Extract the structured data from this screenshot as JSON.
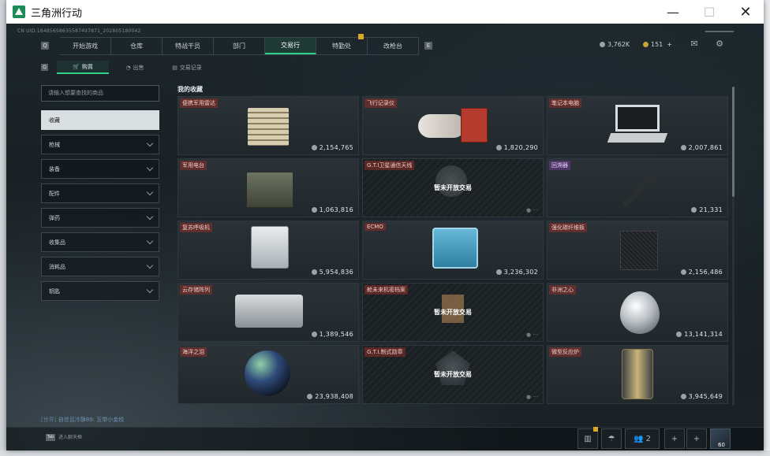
{
  "window": {
    "title": "三角洲行动"
  },
  "uid": "CN UID:18485658635587497871_202805180042",
  "nav": {
    "q_key": "Q",
    "e_key": "E",
    "tabs": [
      {
        "label": "开始游戏"
      },
      {
        "label": "仓库"
      },
      {
        "label": "特战干员"
      },
      {
        "label": "部门"
      },
      {
        "label": "交易行",
        "active": true
      },
      {
        "label": "特勤处"
      },
      {
        "label": "改枪台"
      }
    ]
  },
  "currency": {
    "silver": "3,762K",
    "gold": "151",
    "add": "+"
  },
  "subtabs": {
    "q_key": "Q",
    "items": [
      {
        "label": "购買",
        "active": true
      },
      {
        "label": "出售"
      },
      {
        "label": "交易记录"
      }
    ]
  },
  "sidebar": {
    "search_placeholder": "请输入想要查找的商品",
    "items": [
      {
        "label": "收藏",
        "active": true
      },
      {
        "label": "枪械"
      },
      {
        "label": "装备"
      },
      {
        "label": "配件"
      },
      {
        "label": "弹药"
      },
      {
        "label": "收集品"
      },
      {
        "label": "消耗品"
      },
      {
        "label": "钥匙"
      }
    ]
  },
  "favorites": {
    "title": "我的收藏",
    "locked_text": "暂未开放交易",
    "items": [
      {
        "name": "便携军用雷达",
        "price": "2,154,765",
        "rarity": "red",
        "locked": false
      },
      {
        "name": "飞行记录仪",
        "price": "1,820,290",
        "rarity": "red",
        "locked": false
      },
      {
        "name": "笔记本电脑",
        "price": "2,007,861",
        "rarity": "red",
        "locked": false
      },
      {
        "name": "军用电台",
        "price": "1,063,816",
        "rarity": "red",
        "locked": false
      },
      {
        "name": "G.T.I卫星通信天线",
        "price": "",
        "rarity": "red",
        "locked": true
      },
      {
        "name": "回溯器",
        "price": "21,331",
        "rarity": "purple",
        "locked": false
      },
      {
        "name": "复苏呼吸机",
        "price": "5,954,836",
        "rarity": "red",
        "locked": false
      },
      {
        "name": "ECMO",
        "price": "3,236,302",
        "rarity": "red",
        "locked": false
      },
      {
        "name": "强化碳纤维板",
        "price": "2,156,486",
        "rarity": "red",
        "locked": false
      },
      {
        "name": "云存储阵列",
        "price": "1,389,546",
        "rarity": "red",
        "locked": false
      },
      {
        "name": "舱未来机密档案",
        "price": "",
        "rarity": "red",
        "locked": true
      },
      {
        "name": "非洲之心",
        "price": "13,141,314",
        "rarity": "red",
        "locked": false
      },
      {
        "name": "海洋之泪",
        "price": "23,938,408",
        "rarity": "red",
        "locked": false
      },
      {
        "name": "G.T.I.制式勋章",
        "price": "",
        "rarity": "red",
        "locked": true
      },
      {
        "name": "微型反应炉",
        "price": "3,945,649",
        "rarity": "red",
        "locked": false
      }
    ]
  },
  "chat": {
    "channel": "[世界]",
    "message": "自信且冷静89: 互带小金校"
  },
  "bottom": {
    "tab_key": "Tab",
    "hint": "进入聊天框",
    "friends": "2",
    "level": "60"
  }
}
